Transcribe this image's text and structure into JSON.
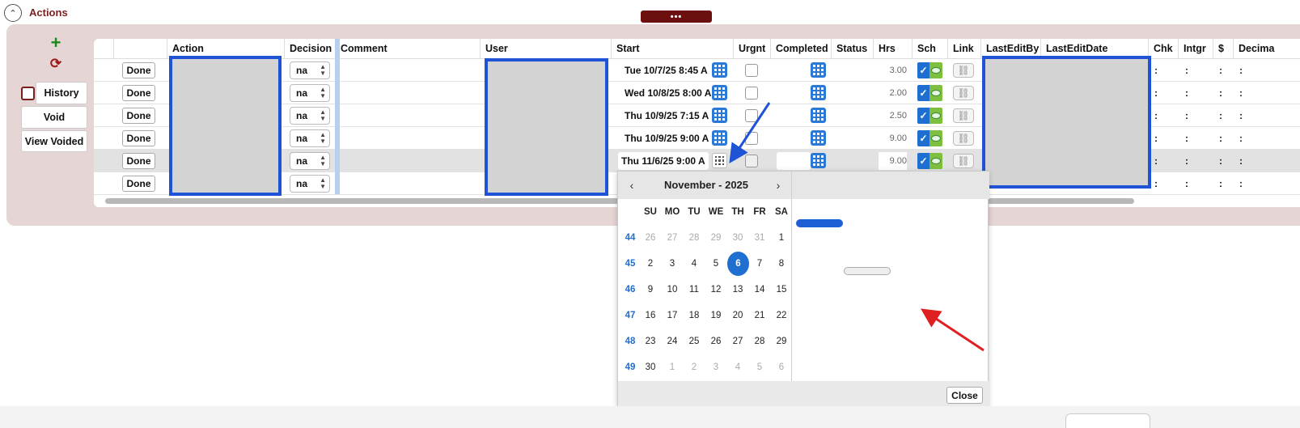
{
  "section": {
    "title": "Actions",
    "collapse_icon": "chevron-up-icon",
    "handle_label": "•••"
  },
  "sidebar": {
    "add_icon": "plus-icon",
    "refresh_icon": "refresh-icon",
    "history_label": "History",
    "void_label": "Void",
    "view_voided_label": "View Voided"
  },
  "grid": {
    "columns": [
      "Action",
      "Decision",
      "Comment",
      "User",
      "Start",
      "Urgnt",
      "Completed",
      "Status",
      "Hrs",
      "Sch",
      "Link",
      "LastEditBy",
      "LastEditDate",
      "Chk",
      "Intgr",
      "$",
      "Decima"
    ],
    "done_label": "Done",
    "rows": [
      {
        "decision": "na",
        "start": "Tue 10/7/25 8:45 A",
        "hrs": "3.00",
        "colon": ":"
      },
      {
        "decision": "na",
        "start": "Wed 10/8/25 8:00 A",
        "hrs": "2.00",
        "colon": ":"
      },
      {
        "decision": "na",
        "start": "Thu 10/9/25 7:15 A",
        "hrs": "2.50",
        "colon": ":"
      },
      {
        "decision": "na",
        "start": "Thu 10/9/25 9:00 A",
        "hrs": "9.00",
        "colon": ":"
      },
      {
        "decision": "na",
        "start": "Thu 11/6/25 9:00 A",
        "hrs": "9.00",
        "colon": ":",
        "selected": true
      },
      {
        "decision": "na",
        "start": "",
        "hrs": "",
        "colon": ":"
      }
    ]
  },
  "picker": {
    "month_title": "November - 2025",
    "prev_icon": "chevron-left-icon",
    "next_icon": "chevron-right-icon",
    "weekdays": [
      "SU",
      "MO",
      "TU",
      "WE",
      "TH",
      "FR",
      "SA"
    ],
    "weeks": [
      {
        "wk": "44",
        "days": [
          "26",
          "27",
          "28",
          "29",
          "30",
          "31",
          "1"
        ]
      },
      {
        "wk": "45",
        "days": [
          "2",
          "3",
          "4",
          "5",
          "6",
          "7",
          "8"
        ]
      },
      {
        "wk": "46",
        "days": [
          "9",
          "10",
          "11",
          "12",
          "13",
          "14",
          "15"
        ]
      },
      {
        "wk": "47",
        "days": [
          "16",
          "17",
          "18",
          "19",
          "20",
          "21",
          "22"
        ]
      },
      {
        "wk": "48",
        "days": [
          "23",
          "24",
          "25",
          "26",
          "27",
          "28",
          "29"
        ]
      },
      {
        "wk": "49",
        "days": [
          "30",
          "1",
          "2",
          "3",
          "4",
          "5",
          "6"
        ]
      }
    ],
    "selected_day": "6",
    "close_label": "Close"
  },
  "colors": {
    "accent_blue": "#1f6fd1",
    "panel_bg": "#e6d5d5",
    "title_red": "#7a1f1f",
    "annotation_blue": "#1f53d6",
    "annotation_red": "#e02020"
  }
}
